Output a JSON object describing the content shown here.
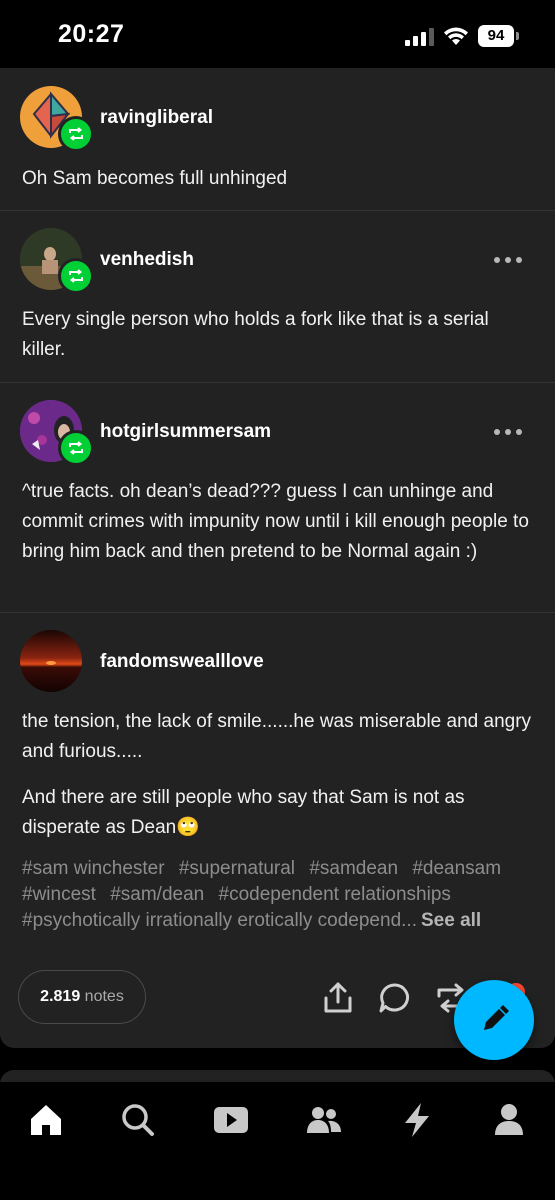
{
  "status": {
    "time": "20:27",
    "battery": "94"
  },
  "posts": [
    {
      "username": "ravingliberal",
      "text": "Oh Sam becomes full unhinged"
    },
    {
      "username": "venhedish",
      "text": "Every single person who holds a fork like that is a serial killer."
    },
    {
      "username": "hotgirlsummersam",
      "text": "^true facts. oh dean’s dead??? guess I can unhinge and commit crimes with impunity now until i kill enough people to bring him back and then pretend to be Normal again :)"
    },
    {
      "username": "fandomswealllove",
      "text1": "the tension, the lack of smile......he was miserable and angry and furious.....",
      "text2": "And there are still people who say that Sam is not as disperate as Dean🙄"
    }
  ],
  "tags": [
    "#sam winchester",
    "#supernatural",
    "#samdean",
    "#deansam",
    "#wincest",
    "#sam/dean",
    "#codependent relationships",
    "#psychotically irrationally erotically codepend..."
  ],
  "see_all": "See all",
  "notes": {
    "count": "2.819",
    "label": "notes"
  },
  "actions": {
    "share": "share-icon",
    "reply": "reply-icon",
    "reblog": "reblog-icon",
    "like": "heart-icon",
    "compose": "pencil-icon"
  },
  "tabbar": [
    "home-icon",
    "search-icon",
    "video-icon",
    "community-icon",
    "activity-icon",
    "account-icon"
  ],
  "colors": {
    "background": "#000000",
    "card": "#222222",
    "reblog_green": "#00cf35",
    "fab_blue": "#00b8ff",
    "tag_gray": "#8d8d8d"
  }
}
